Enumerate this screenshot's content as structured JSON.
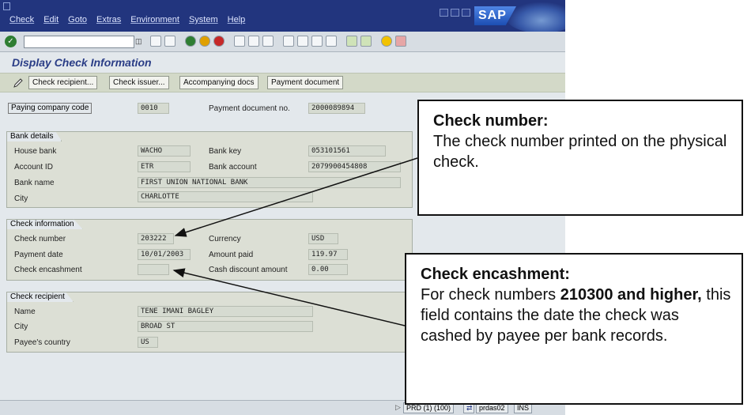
{
  "menu": [
    "Check",
    "Edit",
    "Goto",
    "Extras",
    "Environment",
    "System",
    "Help"
  ],
  "logo": "SAP",
  "screen_title": "Display Check Information",
  "app_buttons": [
    "Check recipient...",
    "Check issuer...",
    "Accompanying docs",
    "Payment document"
  ],
  "header": {
    "paying_company_code_label": "Paying company code",
    "paying_company_code": "0010",
    "payment_document_no_label": "Payment document no.",
    "payment_document_no": "2000089894"
  },
  "bank_details": {
    "title": "Bank details",
    "house_bank_label": "House bank",
    "house_bank": "WACHO",
    "bank_key_label": "Bank key",
    "bank_key": "053101561",
    "account_id_label": "Account ID",
    "account_id": "ETR",
    "bank_account_label": "Bank account",
    "bank_account": "2079900454808",
    "bank_name_label": "Bank name",
    "bank_name": "FIRST UNION NATIONAL BANK",
    "city_label": "City",
    "city": "CHARLOTTE"
  },
  "check_info": {
    "title": "Check information",
    "check_number_label": "Check number",
    "check_number": "203222",
    "currency_label": "Currency",
    "currency": "USD",
    "payment_date_label": "Payment date",
    "payment_date": "10/01/2003",
    "amount_paid_label": "Amount paid",
    "amount_paid": "119.97",
    "check_encashment_label": "Check encashment",
    "check_encashment": "",
    "cash_discount_label": "Cash discount amount",
    "cash_discount": "0.00"
  },
  "recipient": {
    "title": "Check recipient",
    "name_label": "Name",
    "name": "TENE IMANI BAGLEY",
    "city_label": "City",
    "city": "BROAD ST",
    "country_label": "Payee's country",
    "country": "US"
  },
  "status": {
    "system": "PRD (1) (100)",
    "server": "prdas02",
    "mode": "INS"
  },
  "callouts": {
    "check_number_title": "Check number:",
    "check_number_text": "The check number printed on the physical check.",
    "encashment_title": "Check encashment:",
    "encashment_text_1": "For check numbers ",
    "encashment_bold": "210300 and higher,",
    "encashment_text_2": " this field contains the date the check was cashed by payee per bank records."
  }
}
